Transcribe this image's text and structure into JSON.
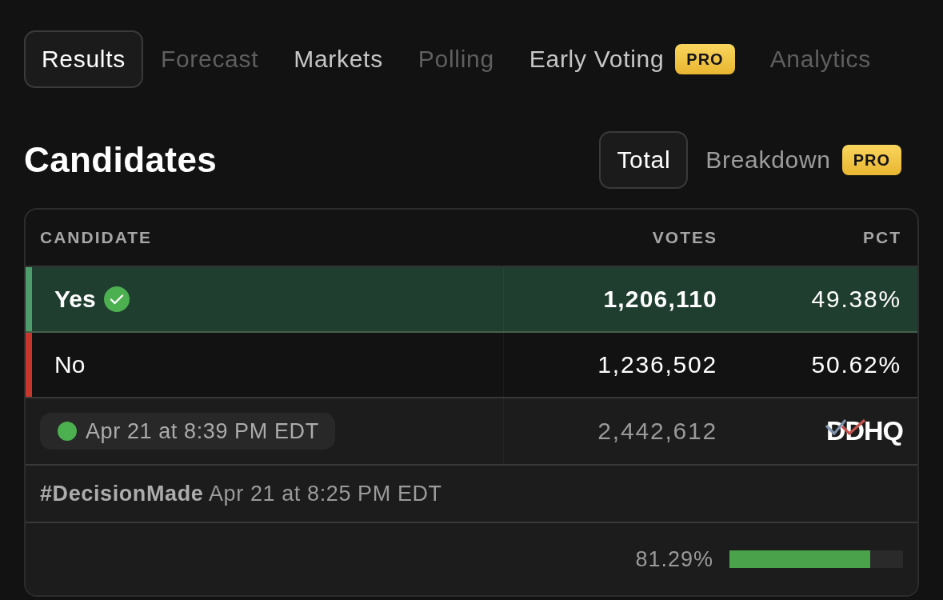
{
  "tabs": [
    {
      "label": "Results",
      "selected": true,
      "disabled": false
    },
    {
      "label": "Forecast",
      "selected": false,
      "disabled": true
    },
    {
      "label": "Markets",
      "selected": false,
      "disabled": false
    },
    {
      "label": "Polling",
      "selected": false,
      "disabled": true
    },
    {
      "label": "Early Voting",
      "selected": false,
      "disabled": false,
      "badge": "PRO"
    },
    {
      "label": "Analytics",
      "selected": false,
      "disabled": true
    }
  ],
  "section": {
    "title": "Candidates",
    "view_toggle": [
      {
        "label": "Total",
        "selected": true
      },
      {
        "label": "Breakdown",
        "selected": false,
        "badge": "PRO"
      }
    ]
  },
  "table": {
    "columns": [
      "CANDIDATE",
      "VOTES",
      "PCT"
    ],
    "rows": [
      {
        "name": "Yes",
        "votes": "1,206,110",
        "pct": "49.38%",
        "winner": true,
        "color": "#4e9c6c"
      },
      {
        "name": "No",
        "votes": "1,236,502",
        "pct": "50.62%",
        "winner": false,
        "color": "#c8372d"
      }
    ],
    "totals": {
      "updated": "Apr 21 at 8:39 PM EDT",
      "votes": "2,442,612",
      "source_logo": "DDHQ"
    },
    "decision": "**#DecisionMade** Apr 21 at 8:25 PM EDT",
    "reporting": {
      "reading": "81.29%",
      "level": 0.8129
    }
  }
}
